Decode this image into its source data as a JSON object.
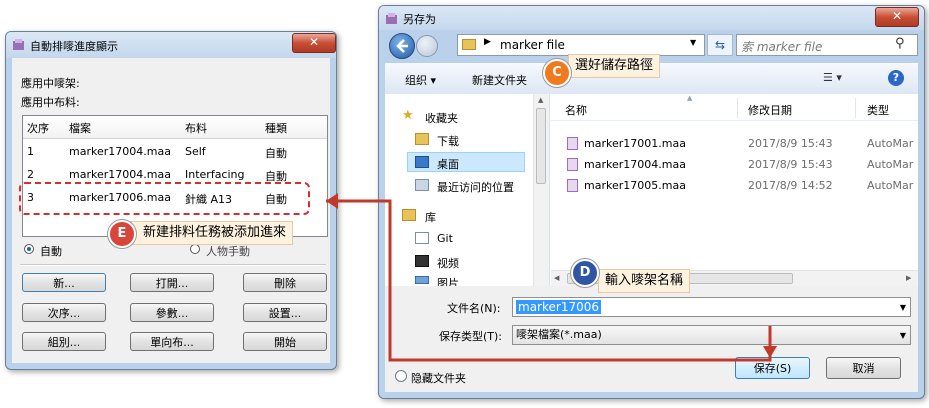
{
  "left_dialog": {
    "title": "自動排嘜進度顯示",
    "close_symbol": "✕",
    "label_marker": "應用中嘜架:",
    "label_fabric": "應用中布料:",
    "table": {
      "headers": [
        "次序",
        "檔案",
        "布料",
        "種類"
      ],
      "rows": [
        [
          "1",
          "marker17004.maa",
          "Self",
          "自動"
        ],
        [
          "2",
          "marker17004.maa",
          "Interfacing",
          "自動"
        ],
        [
          "3",
          "marker17006.maa",
          "針織 A13",
          "自動"
        ]
      ]
    },
    "radio_auto": "自動",
    "radio_manual": "人物手動",
    "buttons": {
      "new": "新...",
      "open": "打開...",
      "delete": "刪除",
      "order": "次序...",
      "params": "參數...",
      "settings": "設置...",
      "group": "組別...",
      "one_way": "單向布...",
      "start": "開始"
    }
  },
  "save_dialog": {
    "title": "另存为",
    "close_symbol": "✕",
    "path_folder": "marker file",
    "search_placeholder": "索 marker file",
    "toolbar": {
      "organize": "组织 ▾",
      "new_folder": "新建文件夹",
      "view": "☰ ▾",
      "help": "?"
    },
    "nav": {
      "favorites": "收藏夹",
      "downloads": "下载",
      "desktop": "桌面",
      "recent": "最近访问的位置",
      "library": "库",
      "git": "Git",
      "video": "视频",
      "pictures": "图片"
    },
    "columns": {
      "name": "名称",
      "modified": "修改日期",
      "type": "类型"
    },
    "files": [
      {
        "name": "marker17001.maa",
        "date": "2017/8/9 15:43",
        "type": "AutoMar"
      },
      {
        "name": "marker17004.maa",
        "date": "2017/8/9 15:43",
        "type": "AutoMar"
      },
      {
        "name": "marker17005.maa",
        "date": "2017/8/9 14:52",
        "type": "AutoMar"
      }
    ],
    "filename_label": "文件名(N):",
    "filename_value": "marker17006",
    "filetype_label": "保存类型(T):",
    "filetype_value": "嘜架檔案(*.maa)",
    "hide_folders": "隐藏文件夹",
    "save_button": "保存(S)",
    "cancel_button": "取消"
  },
  "annotations": {
    "c": {
      "letter": "C",
      "text": "選好儲存路徑",
      "color": "#f07a1e"
    },
    "d": {
      "letter": "D",
      "text": "輸入嘜架名稱",
      "color": "#2f55a4"
    },
    "e": {
      "letter": "E",
      "text": "新建排料任務被添加進來",
      "color": "#d8453a"
    }
  },
  "colors": {
    "arrow": "#c0392b",
    "highlight": "#3399ff",
    "dashed_box": "#d32f2f"
  }
}
